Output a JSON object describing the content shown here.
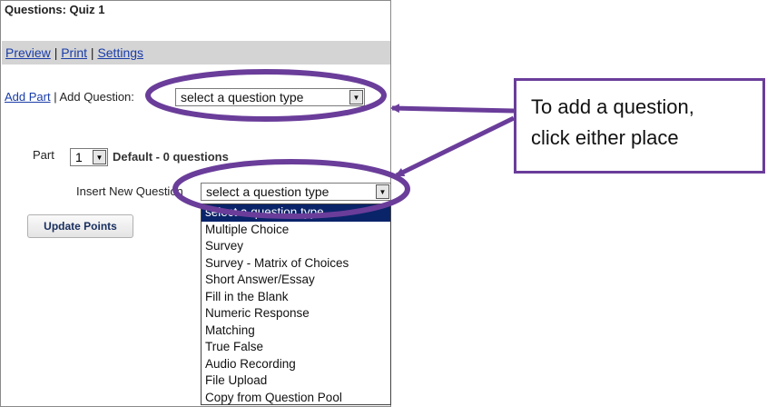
{
  "panel": {
    "title": "Questions: Quiz 1",
    "links": {
      "preview": "Preview",
      "print": "Print",
      "settings": "Settings",
      "sep": "|"
    }
  },
  "add_row": {
    "add_part": "Add Part",
    "sep": "|",
    "add_question_label": "Add Question:",
    "select_value": "select a question type"
  },
  "part_row": {
    "label": "Part",
    "part_number": "1",
    "description": "Default - 0 questions"
  },
  "insert_row": {
    "label": "Insert New Question",
    "select_value": "select a question type"
  },
  "update_points_label": "Update Points",
  "dropdown_options": [
    "select a question type",
    "Multiple Choice",
    "Survey",
    "Survey - Matrix of Choices",
    "Short Answer/Essay",
    "Fill in the Blank",
    "Numeric Response",
    "Matching",
    "True False",
    "Audio Recording",
    "File Upload",
    "Copy from Question Pool"
  ],
  "selected_option_index": 0,
  "callout": {
    "line1": "To add a question,",
    "line2": "click either place"
  },
  "colors": {
    "accent": "#6a3d9a",
    "selection": "#0a246a",
    "link": "#1a3ca8"
  }
}
